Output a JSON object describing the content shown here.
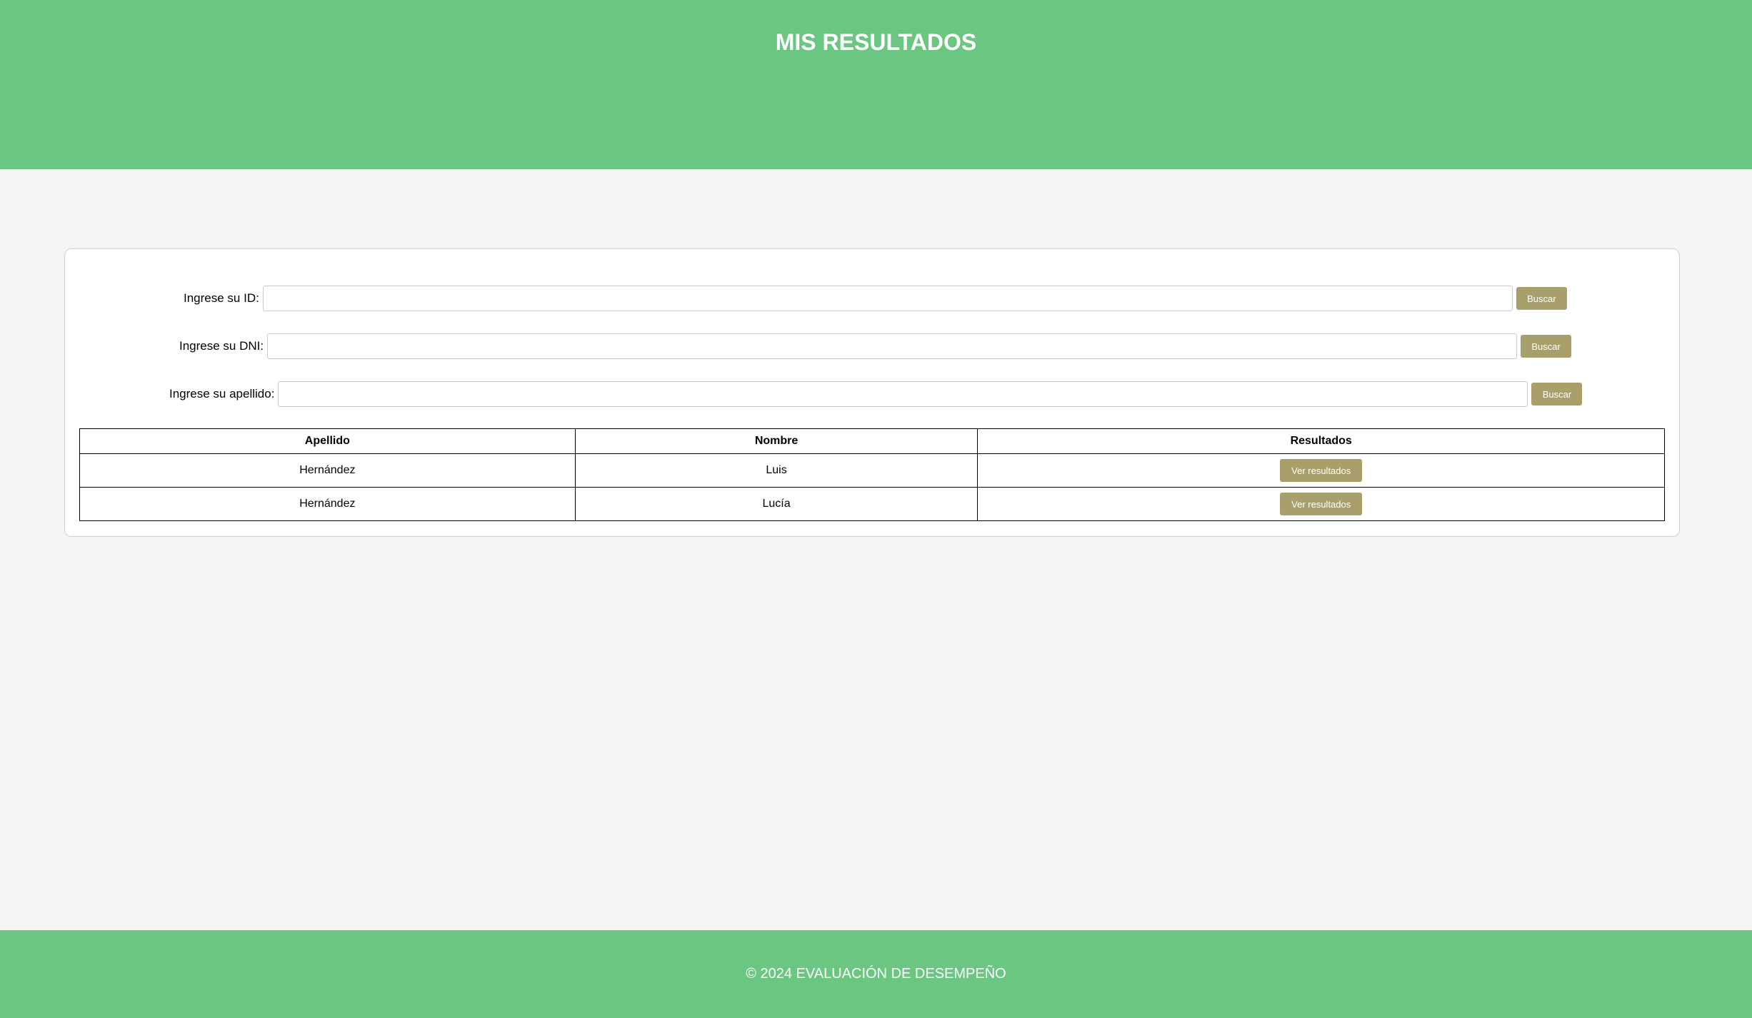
{
  "header": {
    "title": "MIS RESULTADOS"
  },
  "search": {
    "id_label": "Ingrese su ID:",
    "id_value": "",
    "dni_label": "Ingrese su DNI:",
    "dni_value": "",
    "apellido_label": "Ingrese su apellido:",
    "apellido_value": "",
    "button_label": "Buscar"
  },
  "table": {
    "headers": [
      "Apellido",
      "Nombre",
      "Resultados"
    ],
    "rows": [
      {
        "apellido": "Hernández",
        "nombre": "Luis",
        "action": "Ver resultados"
      },
      {
        "apellido": "Hernández",
        "nombre": "Lucía",
        "action": "Ver resultados"
      }
    ]
  },
  "footer": {
    "text": "© 2024 EVALUACIÓN DE DESEMPEÑO"
  },
  "colors": {
    "header_bg": "#6ac680",
    "button_bg": "#a89f6b",
    "page_bg": "#f4f4f4"
  }
}
